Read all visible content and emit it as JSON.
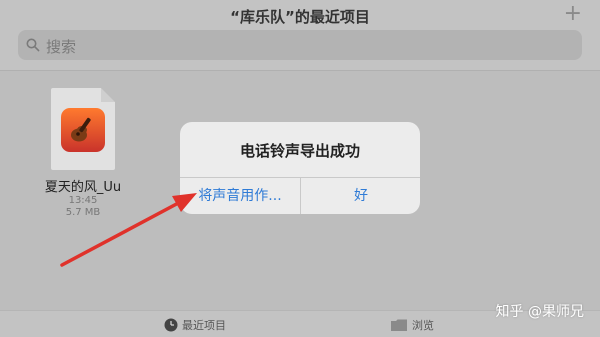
{
  "header": {
    "title": "“库乐队”的最近项目",
    "add_icon": "plus-icon"
  },
  "search": {
    "placeholder": "搜索",
    "icon": "search-icon"
  },
  "file": {
    "name": "夏天的风_Uu",
    "time": "13:45",
    "size": "5.7 MB",
    "icon": "garageband-app-icon"
  },
  "dialog": {
    "message": "电话铃声导出成功",
    "left_button": "将声音用作...",
    "right_button": "好"
  },
  "tabbar": {
    "recent_label": "最近项目",
    "browse_label": "浏览"
  },
  "watermark": "知乎 @果师兄",
  "colors": {
    "accent": "#2f7bd6",
    "arrow": "#e0322b"
  }
}
